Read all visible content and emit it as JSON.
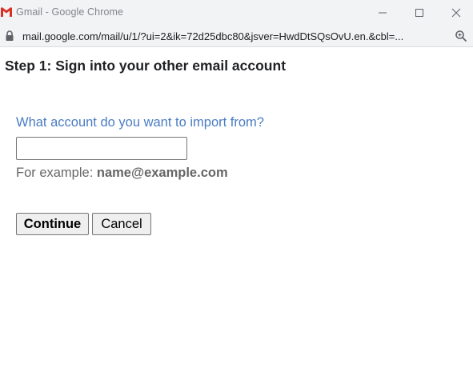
{
  "window": {
    "title": "Gmail - Google Chrome",
    "logo_icon": "gmail-logo-icon",
    "controls": [
      "minimize-icon",
      "maximize-icon",
      "close-icon"
    ]
  },
  "address_bar": {
    "lock_icon": "lock-icon",
    "url": "mail.google.com/mail/u/1/?ui=2&ik=72d25dbc80&jsver=HwdDtSQsOvU.en.&cbl=...",
    "zoom_icon": "zoom-icon"
  },
  "page": {
    "step_title": "Step 1: Sign into your other email account",
    "question": "What account do you want to import from?",
    "email_input_value": "",
    "example_prefix": "For example: ",
    "example_email": "name@example.com",
    "continue_label": "Continue",
    "cancel_label": "Cancel"
  },
  "colors": {
    "question_blue": "#4a7cc4",
    "gmail_red": "#d93025",
    "titlebar_bg": "#f1f3f4"
  }
}
